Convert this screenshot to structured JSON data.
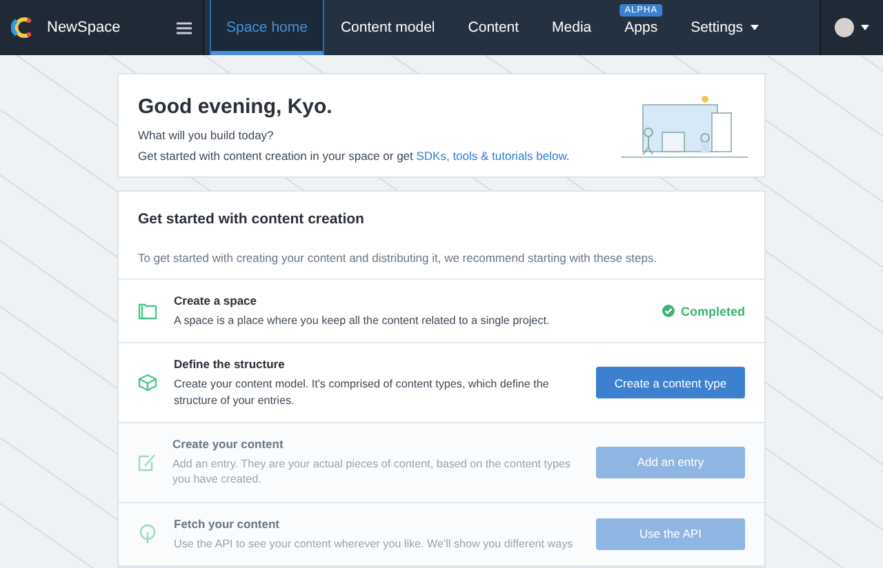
{
  "brand": {
    "name": "NewSpace"
  },
  "nav": [
    {
      "label": "Space home",
      "selected": true
    },
    {
      "label": "Content model",
      "selected": false
    },
    {
      "label": "Content",
      "selected": false
    },
    {
      "label": "Media",
      "selected": false
    },
    {
      "label": "Apps",
      "selected": false,
      "badge": "ALPHA"
    },
    {
      "label": "Settings",
      "selected": false,
      "dropdown": true
    }
  ],
  "welcome": {
    "title": "Good evening, Kyo.",
    "subtitle": "What will you build today?",
    "text": "Get started with content creation in your space or get ",
    "link": "SDKs, tools & tutorials below",
    "after": "."
  },
  "getting_started": {
    "title": "Get started with content creation",
    "intro": "To get started with creating your content and distributing it, we recommend starting with these steps.",
    "steps": [
      {
        "kind": "completed",
        "title": "Create a space",
        "description": "A space is a place where you keep all the content related to a single project.",
        "status": "Completed",
        "disabled": false
      },
      {
        "kind": "action",
        "title": "Define the structure",
        "description": "Create your content model. It's comprised of content types, which define the structure of your entries.",
        "button": "Create a content type",
        "disabled": false
      },
      {
        "kind": "action",
        "title": "Create your content",
        "description": "Add an entry. They are your actual pieces of content, based on the content types you have created.",
        "button": "Add an entry",
        "disabled": true
      },
      {
        "kind": "action",
        "title": "Fetch your content",
        "description": "Use the API to see your content wherever you like. We'll show you different ways",
        "button": "Use the API",
        "disabled": true
      }
    ]
  }
}
